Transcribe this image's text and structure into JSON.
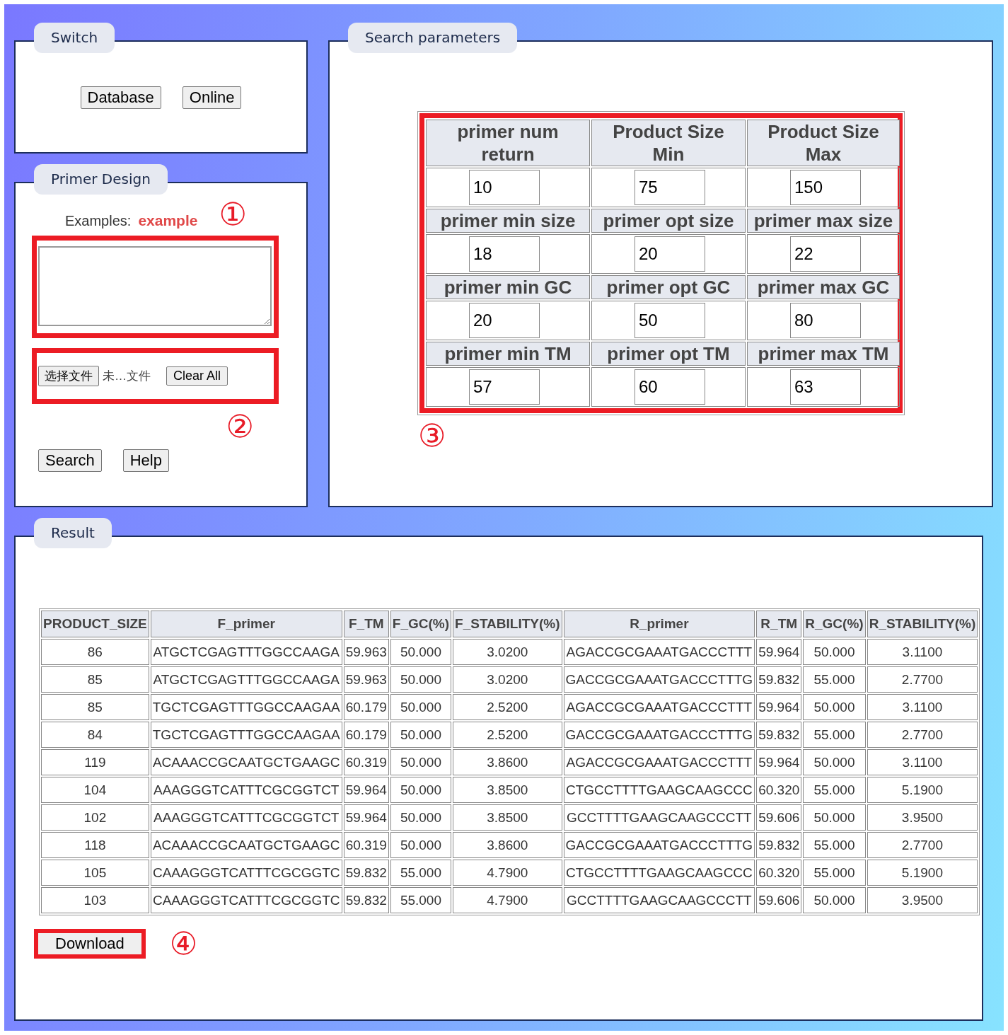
{
  "switch_panel": {
    "title": "Switch",
    "buttons": [
      "Database",
      "Online"
    ]
  },
  "primer_design": {
    "title": "Primer Design",
    "examples_label": "Examples:",
    "example_link": "example",
    "marker_1": "①",
    "file_button": "选择文件",
    "file_status": "未…文件",
    "clear_button": "Clear All",
    "marker_2": "②",
    "buttons": [
      "Search",
      "Help"
    ]
  },
  "search_parameters": {
    "title": "Search parameters",
    "marker": "③",
    "rows": [
      {
        "labels": [
          "primer num return",
          "Product Size Min",
          "Product Size Max"
        ],
        "values": [
          "10",
          "75",
          "150"
        ]
      },
      {
        "labels": [
          "primer min size",
          "primer opt size",
          "primer max size"
        ],
        "values": [
          "18",
          "20",
          "22"
        ]
      },
      {
        "labels": [
          "primer min GC",
          "primer opt GC",
          "primer max GC"
        ],
        "values": [
          "20",
          "50",
          "80"
        ]
      },
      {
        "labels": [
          "primer min TM",
          "primer opt TM",
          "primer max TM"
        ],
        "values": [
          "57",
          "60",
          "63"
        ]
      }
    ]
  },
  "result": {
    "title": "Result",
    "columns": [
      "PRODUCT_SIZE",
      "F_primer",
      "F_TM",
      "F_GC(%)",
      "F_STABILITY(%)",
      "R_primer",
      "R_TM",
      "R_GC(%)",
      "R_STABILITY(%)"
    ],
    "rows": [
      [
        "86",
        "ATGCTCGAGTTTGGCCAAGA",
        "59.963",
        "50.000",
        "3.0200",
        "AGACCGCGAAATGACCCTTT",
        "59.964",
        "50.000",
        "3.1100"
      ],
      [
        "85",
        "ATGCTCGAGTTTGGCCAAGA",
        "59.963",
        "50.000",
        "3.0200",
        "GACCGCGAAATGACCCTTTG",
        "59.832",
        "55.000",
        "2.7700"
      ],
      [
        "85",
        "TGCTCGAGTTTGGCCAAGAA",
        "60.179",
        "50.000",
        "2.5200",
        "AGACCGCGAAATGACCCTTT",
        "59.964",
        "50.000",
        "3.1100"
      ],
      [
        "84",
        "TGCTCGAGTTTGGCCAAGAA",
        "60.179",
        "50.000",
        "2.5200",
        "GACCGCGAAATGACCCTTTG",
        "59.832",
        "55.000",
        "2.7700"
      ],
      [
        "119",
        "ACAAACCGCAATGCTGAAGC",
        "60.319",
        "50.000",
        "3.8600",
        "AGACCGCGAAATGACCCTTT",
        "59.964",
        "50.000",
        "3.1100"
      ],
      [
        "104",
        "AAAGGGTCATTTCGCGGTCT",
        "59.964",
        "50.000",
        "3.8500",
        "CTGCCTTTTGAAGCAAGCCC",
        "60.320",
        "55.000",
        "5.1900"
      ],
      [
        "102",
        "AAAGGGTCATTTCGCGGTCT",
        "59.964",
        "50.000",
        "3.8500",
        "GCCTTTTGAAGCAAGCCCTT",
        "59.606",
        "50.000",
        "3.9500"
      ],
      [
        "118",
        "ACAAACCGCAATGCTGAAGC",
        "60.319",
        "50.000",
        "3.8600",
        "GACCGCGAAATGACCCTTTG",
        "59.832",
        "55.000",
        "2.7700"
      ],
      [
        "105",
        "CAAAGGGTCATTTCGCGGTC",
        "59.832",
        "55.000",
        "4.7900",
        "CTGCCTTTTGAAGCAAGCCC",
        "60.320",
        "55.000",
        "5.1900"
      ],
      [
        "103",
        "CAAAGGGTCATTTCGCGGTC",
        "59.832",
        "55.000",
        "4.7900",
        "GCCTTTTGAAGCAAGCCCTT",
        "59.606",
        "50.000",
        "3.9500"
      ]
    ],
    "download_button": "Download",
    "marker": "④"
  }
}
